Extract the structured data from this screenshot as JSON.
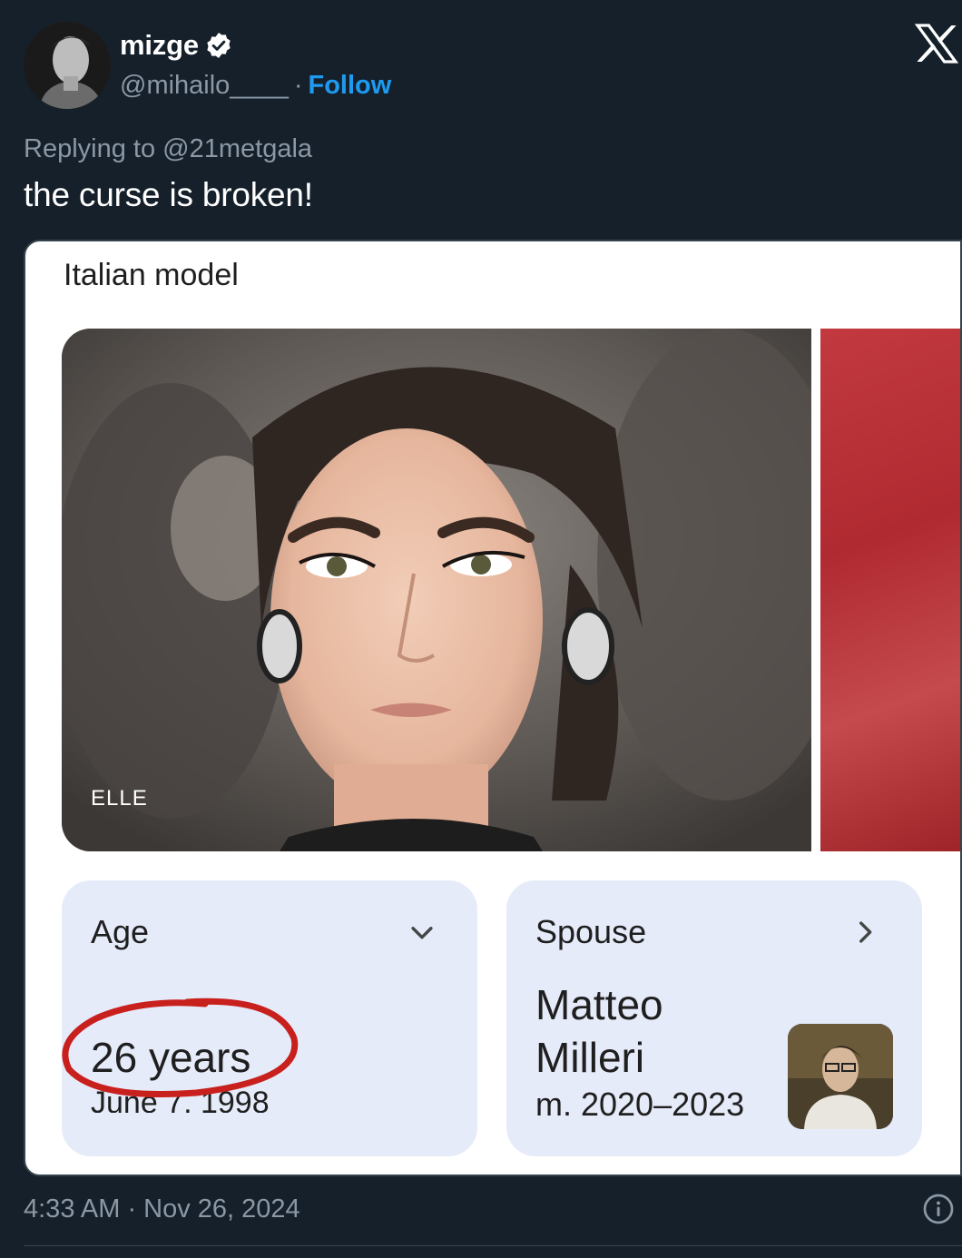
{
  "author": {
    "display_name": "mizge",
    "handle": "@mihailo____",
    "separator": "·",
    "follow_label": "Follow",
    "verified": true
  },
  "reply": {
    "prefix": "Replying to",
    "target": "@21metgala"
  },
  "tweet": {
    "text": "the curse is broken!",
    "timestamp": "4:33 AM · Nov 26, 2024"
  },
  "embed": {
    "subtitle": "Italian model",
    "photo_credit": "ELLE",
    "age": {
      "label": "Age",
      "value": "26 years",
      "birth_date": "June 7, 1998"
    },
    "spouse": {
      "label": "Spouse",
      "name": "Matteo Milleri",
      "years": "m. 2020–2023"
    }
  },
  "colors": {
    "background": "#15202b",
    "accent": "#1d9bf0",
    "muted": "#8b98a5",
    "info_card": "#e6ebfa",
    "annotation": "#c8201c"
  },
  "icons": [
    "x-logo-icon",
    "verified-badge-icon",
    "chevron-down-icon",
    "chevron-right-icon",
    "info-icon"
  ]
}
